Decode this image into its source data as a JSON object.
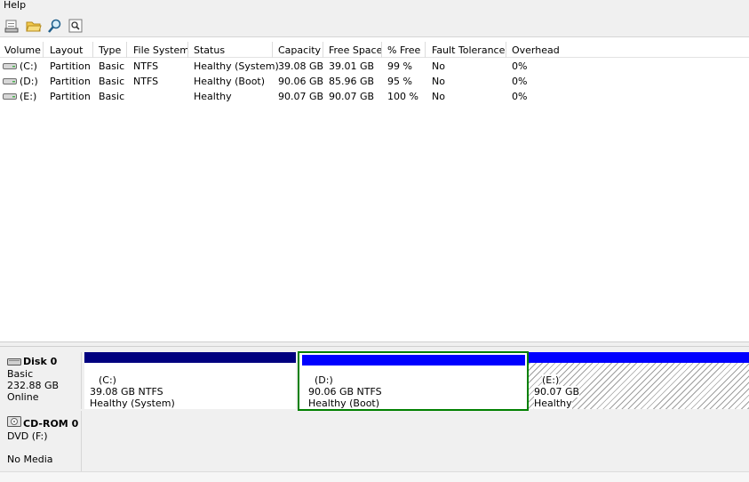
{
  "menu": {
    "help": "Help"
  },
  "toolbar": {
    "buttons": [
      {
        "icon": "disk-properties-icon"
      },
      {
        "icon": "open-folder-icon"
      },
      {
        "icon": "search-icon"
      },
      {
        "icon": "zoom-icon"
      }
    ]
  },
  "volume_list": {
    "columns": [
      "Volume",
      "Layout",
      "Type",
      "File System",
      "Status",
      "Capacity",
      "Free Space",
      "% Free",
      "Fault Tolerance",
      "Overhead"
    ],
    "rows": [
      {
        "volume": "(C:)",
        "layout": "Partition",
        "type": "Basic",
        "fs": "NTFS",
        "status": "Healthy (System)",
        "capacity": "39.08 GB",
        "free": "39.01 GB",
        "pct": "99 %",
        "fault": "No",
        "overhead": "0%"
      },
      {
        "volume": "(D:)",
        "layout": "Partition",
        "type": "Basic",
        "fs": "NTFS",
        "status": "Healthy (Boot)",
        "capacity": "90.06 GB",
        "free": "85.96 GB",
        "pct": "95 %",
        "fault": "No",
        "overhead": "0%"
      },
      {
        "volume": "(E:)",
        "layout": "Partition",
        "type": "Basic",
        "fs": "",
        "status": "Healthy",
        "capacity": "90.07 GB",
        "free": "90.07 GB",
        "pct": "100 %",
        "fault": "No",
        "overhead": "0%"
      }
    ]
  },
  "disks": [
    {
      "title": "Disk 0",
      "type": "Basic",
      "size": "232.88 GB",
      "state": "Online",
      "partitions": [
        {
          "name": "(C:)",
          "size_fs": "39.08 GB NTFS",
          "status": "Healthy (System)",
          "bar_color": "#00007f"
        },
        {
          "name": "(D:)",
          "size_fs": "90.06 GB NTFS",
          "status": "Healthy (Boot)",
          "bar_color": "#0000ff"
        },
        {
          "name": "(E:)",
          "size_fs": "90.07 GB",
          "status": "Healthy",
          "bar_color": "#0000ff"
        }
      ]
    },
    {
      "title": "CD-ROM 0",
      "type": "DVD (F:)",
      "state": "No Media"
    }
  ],
  "colors": {
    "primary_partition": "#00007f",
    "logical_partition": "#0000ff",
    "selected_outline": "#008000"
  }
}
